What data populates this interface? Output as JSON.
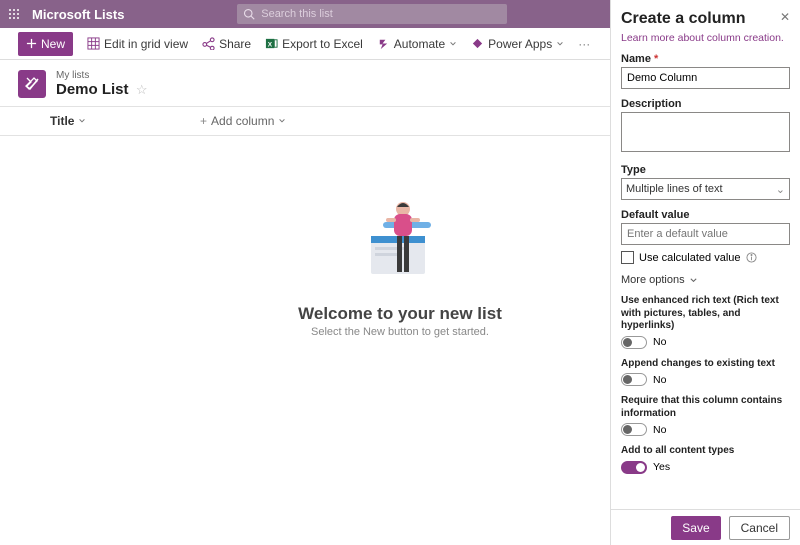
{
  "suite": {
    "app_name": "Microsoft Lists",
    "search_placeholder": "Search this list"
  },
  "cmd": {
    "new": "New",
    "grid": "Edit in grid view",
    "share": "Share",
    "export": "Export to Excel",
    "automate": "Automate",
    "powerapps": "Power Apps"
  },
  "list": {
    "breadcrumb": "My lists",
    "title": "Demo List"
  },
  "cols": {
    "title": "Title",
    "add": "Add column"
  },
  "empty": {
    "heading": "Welcome to your new list",
    "sub": "Select the New button to get started."
  },
  "panel": {
    "heading": "Create a column",
    "learn": "Learn more about column creation.",
    "name_label": "Name",
    "name_value": "Demo Column",
    "desc_label": "Description",
    "type_label": "Type",
    "type_value": "Multiple lines of text",
    "default_label": "Default value",
    "default_placeholder": "Enter a default value",
    "calc_label": "Use calculated value",
    "more": "More options",
    "opt_rich": "Use enhanced rich text (Rich text with pictures, tables, and hyperlinks)",
    "opt_append": "Append changes to existing text",
    "opt_require": "Require that this column contains information",
    "opt_addall": "Add to all content types",
    "no": "No",
    "yes": "Yes",
    "save": "Save",
    "cancel": "Cancel"
  }
}
